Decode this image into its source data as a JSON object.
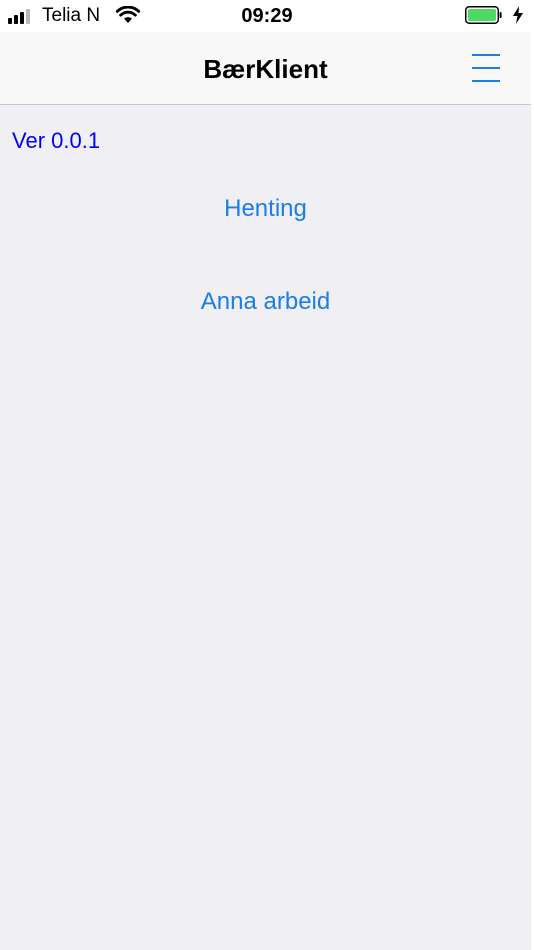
{
  "status_bar": {
    "carrier": "Telia N",
    "time": "09:29",
    "signal_bars_filled": 3,
    "signal_bars_total": 4,
    "wifi_icon": "wifi-icon",
    "battery_icon": "battery-icon",
    "battery_level": 1.0,
    "charging_icon": "charging-bolt-icon"
  },
  "nav": {
    "title": "BærKlient",
    "menu_icon": "hamburger-menu-icon"
  },
  "main": {
    "version": "Ver 0.0.1",
    "links": [
      {
        "label": "Henting"
      },
      {
        "label": "Anna arbeid"
      }
    ]
  },
  "colors": {
    "link": "#1a7ee6",
    "version_text": "#0000ff",
    "background": "#efeff4",
    "nav_background": "#f8f8f8",
    "battery_fill": "#4cd964"
  }
}
